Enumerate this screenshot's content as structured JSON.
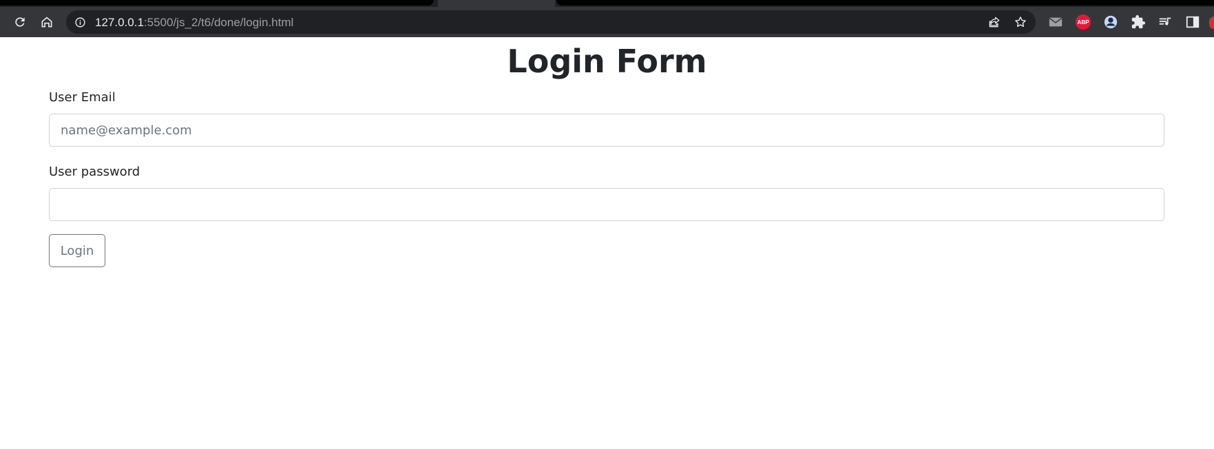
{
  "browser": {
    "address_bar": {
      "host": "127.0.0.1",
      "path": ":5500/js_2/t6/done/login.html"
    },
    "icons": {
      "reload": "reload-icon",
      "home": "home-icon",
      "site_info": "info-icon",
      "share": "share-icon",
      "bookmark": "star-icon",
      "mail_extension": "mail-icon",
      "adblock_extension": "adblock-icon",
      "profile_extension": "profile-icon",
      "extensions": "puzzle-icon",
      "media": "media-queue-icon",
      "side_panel": "side-panel-icon"
    },
    "adblock_badge": "ABP",
    "colors": {
      "chrome_toolbar": "#35363a",
      "omnibox": "#202124",
      "abp_red": "#e8173a"
    }
  },
  "page": {
    "title": "Login Form",
    "email": {
      "label": "User Email",
      "placeholder": "name@example.com",
      "value": ""
    },
    "password": {
      "label": "User password",
      "placeholder": "",
      "value": ""
    },
    "login_button": "Login",
    "colors": {
      "text": "#212529",
      "input_border": "#ced4da",
      "button_outline": "#6c757d"
    }
  }
}
